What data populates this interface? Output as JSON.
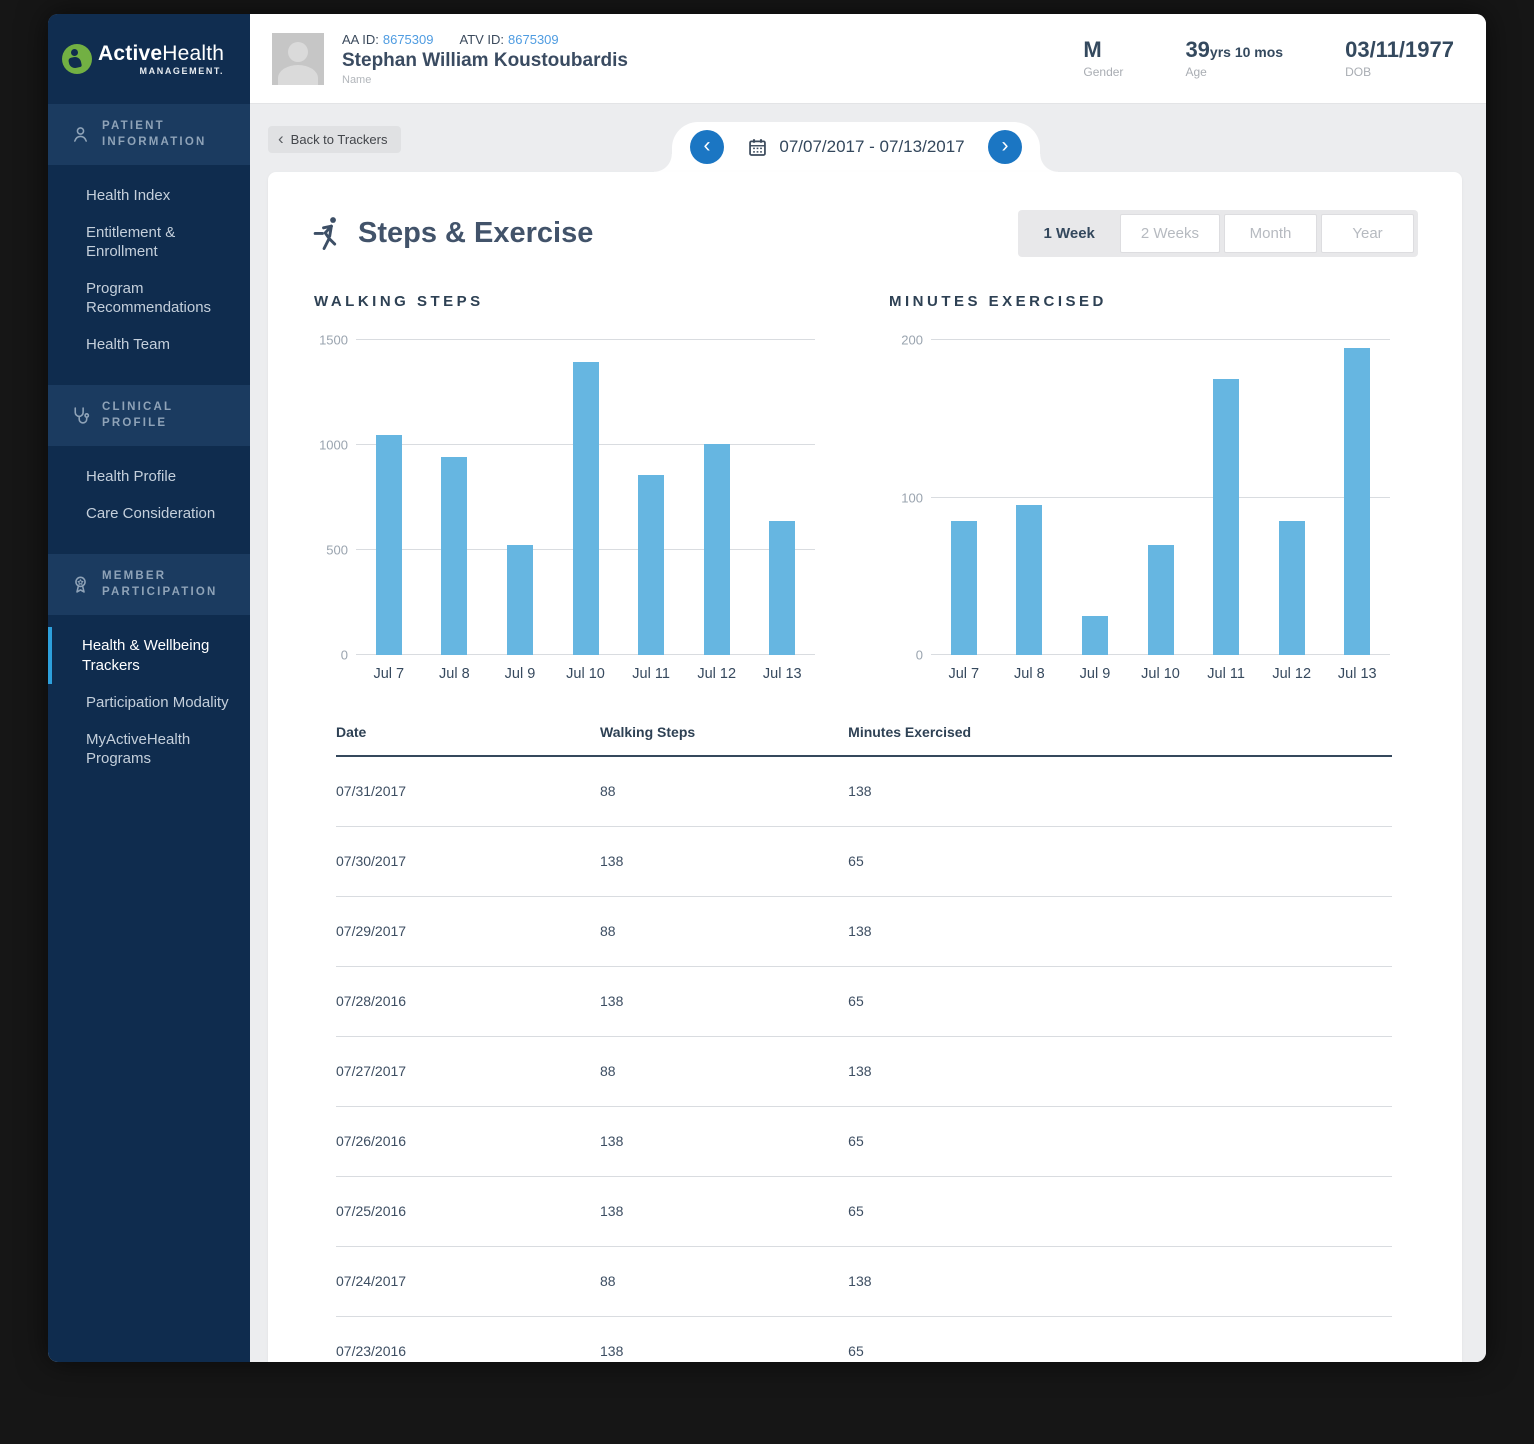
{
  "brand": {
    "part1": "Active",
    "part2": "Health",
    "tagline": "MANAGEMENT."
  },
  "sidebar": {
    "sections": [
      {
        "label": "Patient Information",
        "icon": "person-icon",
        "items": [
          {
            "label": "Health Index"
          },
          {
            "label": "Entitlement & Enrollment"
          },
          {
            "label": "Program Recommendations"
          },
          {
            "label": "Health Team"
          }
        ]
      },
      {
        "label": "Clinical Profile",
        "icon": "stethoscope-icon",
        "items": [
          {
            "label": "Health Profile"
          },
          {
            "label": "Care Consideration"
          }
        ]
      },
      {
        "label": "Member Participation",
        "icon": "medal-icon",
        "items": [
          {
            "label": "Health & Wellbeing Trackers",
            "active": true
          },
          {
            "label": "Participation Modality"
          },
          {
            "label": "MyActiveHealth Programs"
          }
        ]
      }
    ]
  },
  "patient": {
    "aa_id_label": "AA ID:",
    "aa_id": "8675309",
    "atv_id_label": "ATV ID:",
    "atv_id": "8675309",
    "name": "Stephan William Koustoubardis",
    "name_label": "Name",
    "gender": "M",
    "gender_label": "Gender",
    "age": "39",
    "age_suffix": "yrs 10 mos",
    "age_label": "Age",
    "dob": "03/11/1977",
    "dob_label": "DOB"
  },
  "toolbar": {
    "back_label": "Back to Trackers",
    "prev_glyph": "‹",
    "next_glyph": "›",
    "date_range": "07/07/2017 - 07/13/2017"
  },
  "main": {
    "title": "Steps & Exercise",
    "period_tabs": [
      {
        "label": "1 Week",
        "active": true
      },
      {
        "label": "2 Weeks",
        "active": false
      },
      {
        "label": "Month",
        "active": false
      },
      {
        "label": "Year",
        "active": false
      }
    ]
  },
  "chart_data": [
    {
      "type": "bar",
      "title": "WALKING STEPS",
      "categories": [
        "Jul 7",
        "Jul 8",
        "Jul 9",
        "Jul 10",
        "Jul 11",
        "Jul 12",
        "Jul 13"
      ],
      "values": [
        1050,
        945,
        525,
        1395,
        855,
        1005,
        640
      ],
      "yticks": [
        0,
        500,
        1000,
        1500
      ],
      "ylim": [
        0,
        1500
      ],
      "grid": true,
      "legend": "none",
      "xlabel": "",
      "ylabel": ""
    },
    {
      "type": "bar",
      "title": "MINUTES EXERCISED",
      "categories": [
        "Jul 7",
        "Jul 8",
        "Jul 9",
        "Jul 10",
        "Jul 11",
        "Jul 12",
        "Jul 13"
      ],
      "values": [
        85,
        95,
        25,
        70,
        175,
        85,
        195
      ],
      "yticks": [
        0,
        100,
        200
      ],
      "ylim": [
        0,
        200
      ],
      "grid": true,
      "legend": "none",
      "xlabel": "",
      "ylabel": ""
    }
  ],
  "table": {
    "columns": [
      "Date",
      "Walking Steps",
      "Minutes Exercised"
    ],
    "rows": [
      [
        "07/31/2017",
        "88",
        "138"
      ],
      [
        "07/30/2017",
        "138",
        "65"
      ],
      [
        "07/29/2017",
        "88",
        "138"
      ],
      [
        "07/28/2016",
        "138",
        "65"
      ],
      [
        "07/27/2017",
        "88",
        "138"
      ],
      [
        "07/26/2016",
        "138",
        "65"
      ],
      [
        "07/25/2016",
        "138",
        "65"
      ],
      [
        "07/24/2017",
        "88",
        "138"
      ],
      [
        "07/23/2016",
        "138",
        "65"
      ]
    ]
  },
  "colors": {
    "sidebar_navy": "#0f2c4e",
    "section_navy": "#1b3b60",
    "accent_blue": "#2da0dc",
    "circle_blue": "#1b76c3",
    "link_blue": "#4f9ce1",
    "bar_blue": "#66b6e1",
    "text_dark": "#33475c",
    "logo_green": "#72b043"
  }
}
